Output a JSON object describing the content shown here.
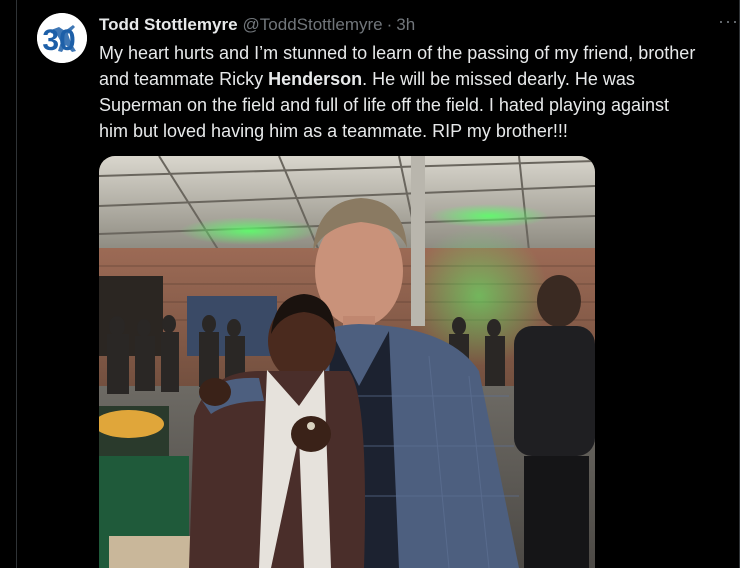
{
  "author": {
    "name": "Todd Stottlemyre",
    "handle": "@ToddStottlemyre",
    "separator": "·",
    "time": "3h"
  },
  "avatar": {
    "badge_text": "30",
    "icon": "pitcher-silhouette-logo"
  },
  "tweet": {
    "line1": "My heart hurts and I’m stunned to learn of the passing of my friend, brother",
    "line2_a": "and teammate Ricky ",
    "line2_bold": "Henderson",
    "line2_b": ". He will be missed dearly. He was",
    "line3": "Superman on the field and full of life off the field. I hated playing against",
    "line4": "him but loved having him as a teammate. RIP my brother!!!"
  },
  "more_button": {
    "label": "···",
    "icon": "more-horizontal-icon"
  },
  "photo": {
    "description_icon": "tweet-photo"
  },
  "colors": {
    "background": "#000000",
    "text": "#e7e9ea",
    "muted": "#71767b",
    "border": "#2f3336",
    "avatar_blue": "#1d5fa8"
  }
}
